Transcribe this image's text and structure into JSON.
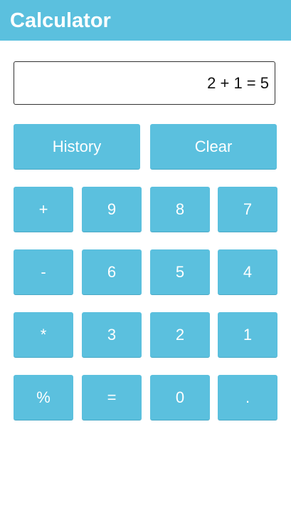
{
  "header": {
    "title": "Calculator"
  },
  "display": {
    "value": "2 + 1 = 5"
  },
  "actions": {
    "history_label": "History",
    "clear_label": "Clear"
  },
  "keypad": [
    [
      "+",
      "9",
      "8",
      "7"
    ],
    [
      "-",
      "6",
      "5",
      "4"
    ],
    [
      "*",
      "3",
      "2",
      "1"
    ],
    [
      "%",
      "=",
      "0",
      "."
    ]
  ],
  "colors": {
    "accent": "#5bc0de",
    "background": "#ffffff",
    "text": "#111111"
  }
}
